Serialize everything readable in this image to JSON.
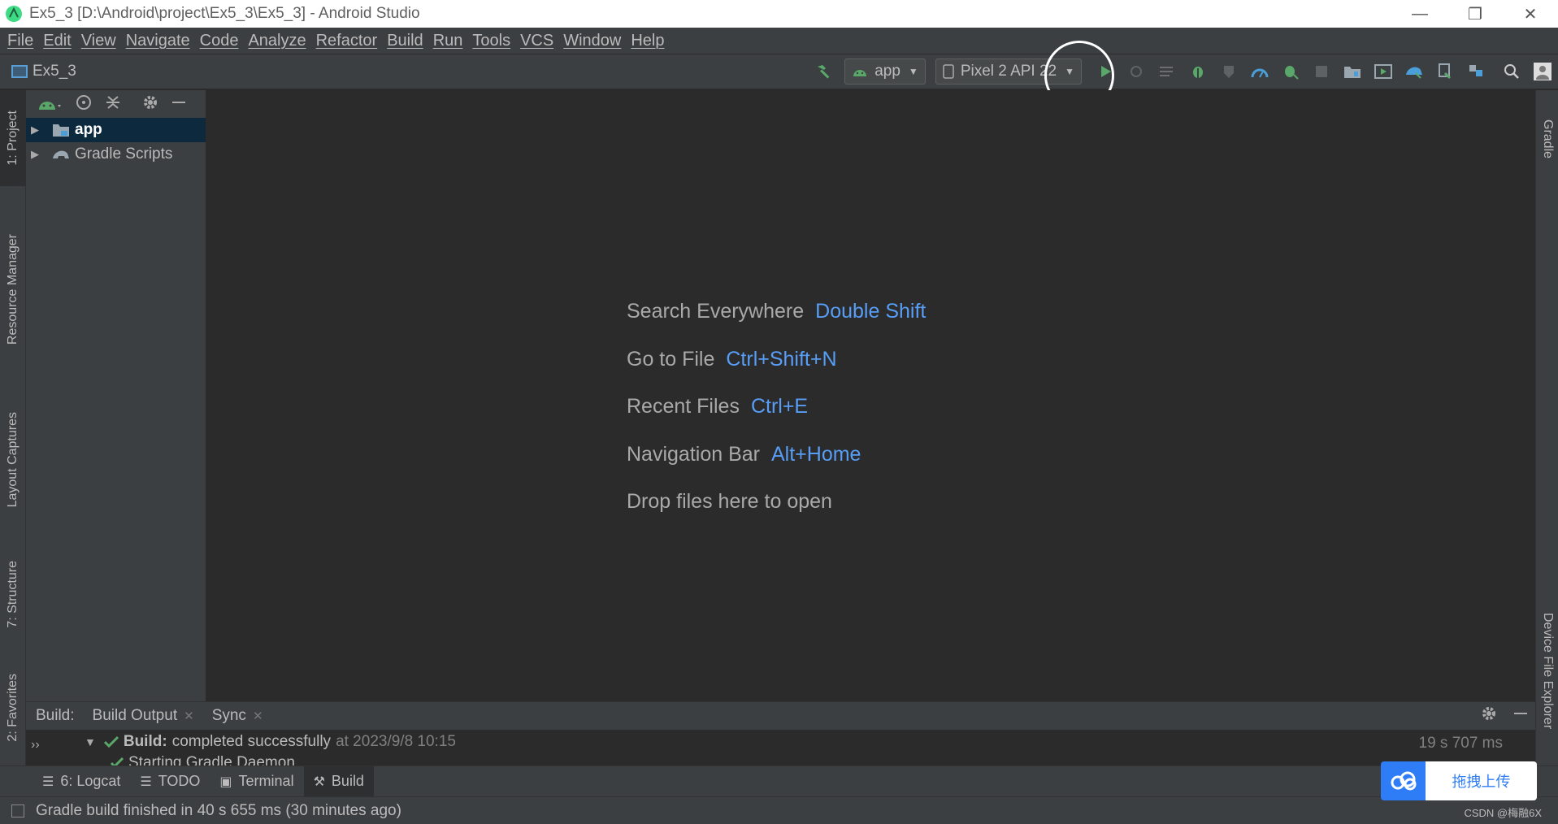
{
  "window": {
    "title": "Ex5_3 [D:\\Android\\project\\Ex5_3\\Ex5_3] - Android Studio",
    "minimize": "—",
    "restore": "❐",
    "close": "✕"
  },
  "menu": [
    "File",
    "Edit",
    "View",
    "Navigate",
    "Code",
    "Analyze",
    "Refactor",
    "Build",
    "Run",
    "Tools",
    "VCS",
    "Window",
    "Help"
  ],
  "navbar": {
    "project": "Ex5_3",
    "run_config": "app",
    "device": "Pixel 2 API 22"
  },
  "left_stripe": {
    "project": "1: Project",
    "resource_manager": "Resource Manager",
    "layout_captures": "Layout Captures",
    "structure": "7: Structure",
    "favorites": "2: Favorites"
  },
  "right_stripe": {
    "gradle": "Gradle",
    "device_file_explorer": "Device File Explorer"
  },
  "project_tree": [
    {
      "label": "app",
      "selected": true
    },
    {
      "label": "Gradle Scripts",
      "selected": false
    }
  ],
  "editor_hints": [
    {
      "label": "Search Everywhere",
      "shortcut": "Double Shift"
    },
    {
      "label": "Go to File",
      "shortcut": "Ctrl+Shift+N"
    },
    {
      "label": "Recent Files",
      "shortcut": "Ctrl+E"
    },
    {
      "label": "Navigation Bar",
      "shortcut": "Alt+Home"
    },
    {
      "label": "Drop files here to open",
      "shortcut": ""
    }
  ],
  "build_panel": {
    "prefix": "Build:",
    "tabs": [
      "Build Output",
      "Sync"
    ],
    "result_label": "Build:",
    "result_text": "completed successfully",
    "result_time": "at 2023/9/8 10:15",
    "duration": "19 s 707 ms",
    "sub_line": "Starting Gradle Daemon"
  },
  "bottom_tabs": [
    {
      "label": "6: Logcat",
      "icon": "logcat-icon"
    },
    {
      "label": "TODO",
      "icon": "todo-icon"
    },
    {
      "label": "Terminal",
      "icon": "terminal-icon"
    },
    {
      "label": "Build",
      "icon": "hammer-icon"
    }
  ],
  "status": "Gradle build finished in 40 s 655 ms (30 minutes ago)",
  "upload": {
    "label": "拖拽上传"
  },
  "watermark": "CSDN @梅融6X",
  "colors": {
    "accent_blue": "#589df6",
    "selection": "#0d293e",
    "run_green": "#59a869"
  }
}
